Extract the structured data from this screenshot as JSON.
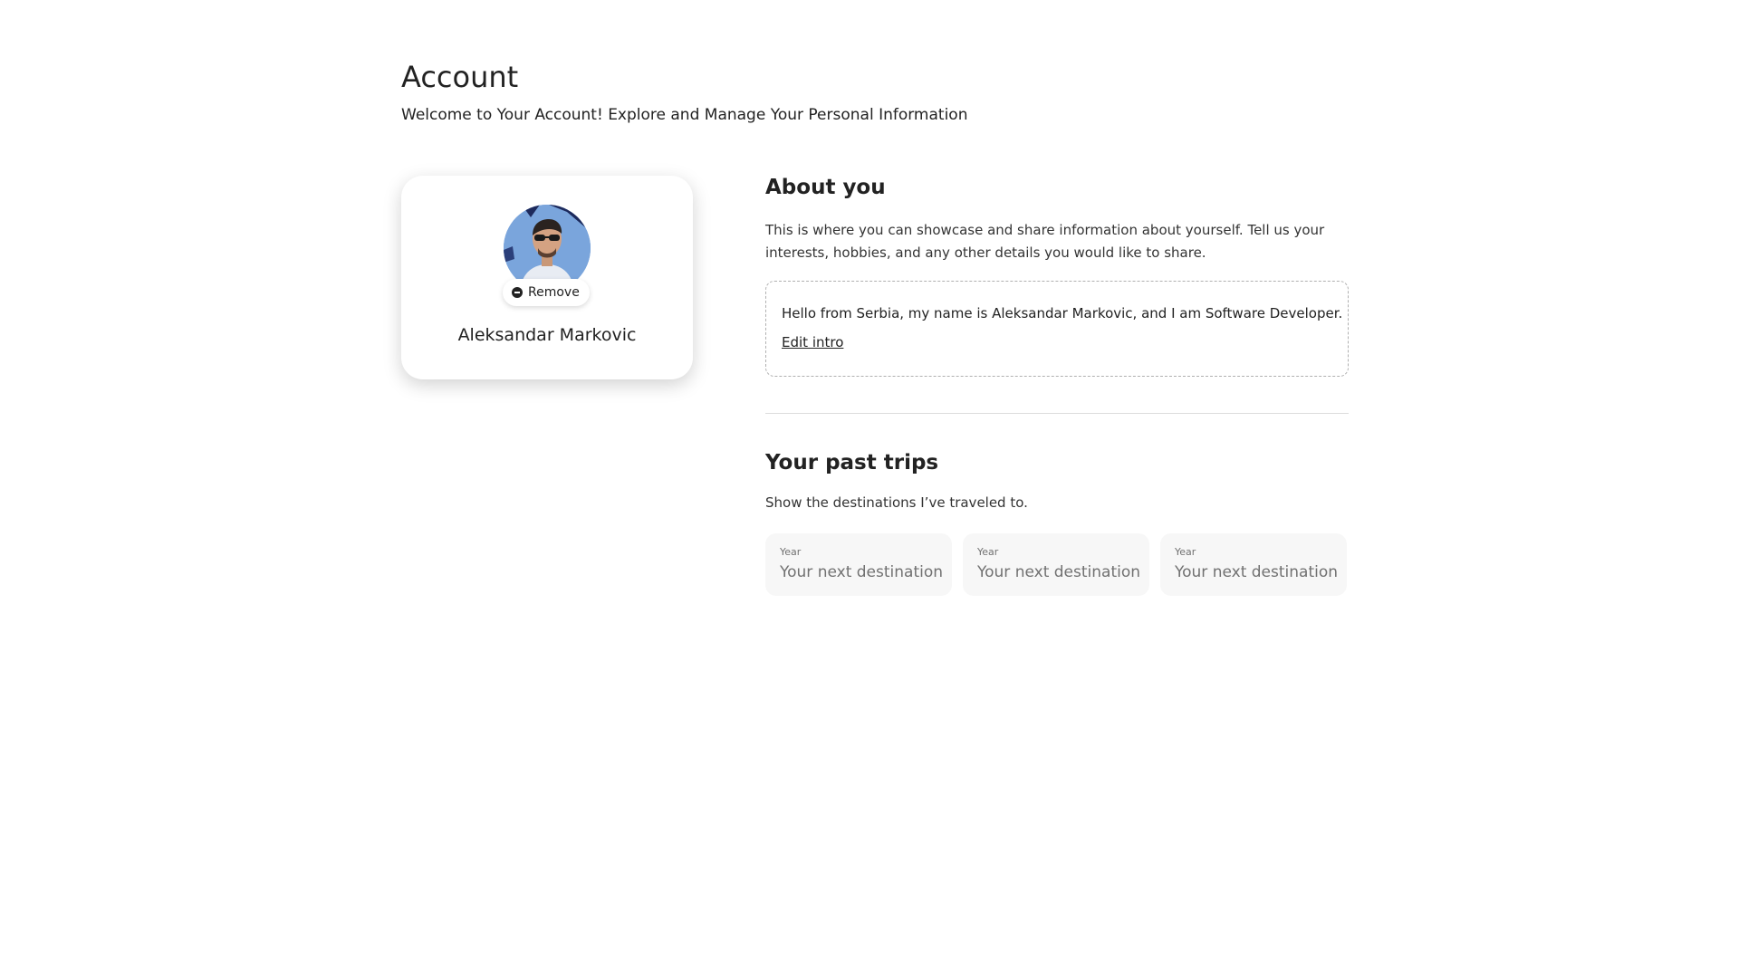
{
  "header": {
    "title": "Account",
    "subtitle": "Welcome to Your Account! Explore and Manage Your Personal Information"
  },
  "profile": {
    "avatar_icon": "user-photo",
    "remove_label": "Remove",
    "name": "Aleksandar Markovic"
  },
  "about": {
    "title": "About you",
    "description": "This is where you can showcase and share information about yourself. Tell us your interests, hobbies, and any other details you would like to share.",
    "intro": "Hello from Serbia, my name is Aleksandar Markovic, and I am Software Developer.",
    "edit_label": "Edit intro"
  },
  "trips": {
    "title": "Your past trips",
    "description": "Show the destinations I’ve traveled to.",
    "cards": [
      {
        "year_label": "Year",
        "destination_placeholder": "Your next destination"
      },
      {
        "year_label": "Year",
        "destination_placeholder": "Your next destination"
      },
      {
        "year_label": "Year",
        "destination_placeholder": "Your next destination"
      }
    ]
  }
}
